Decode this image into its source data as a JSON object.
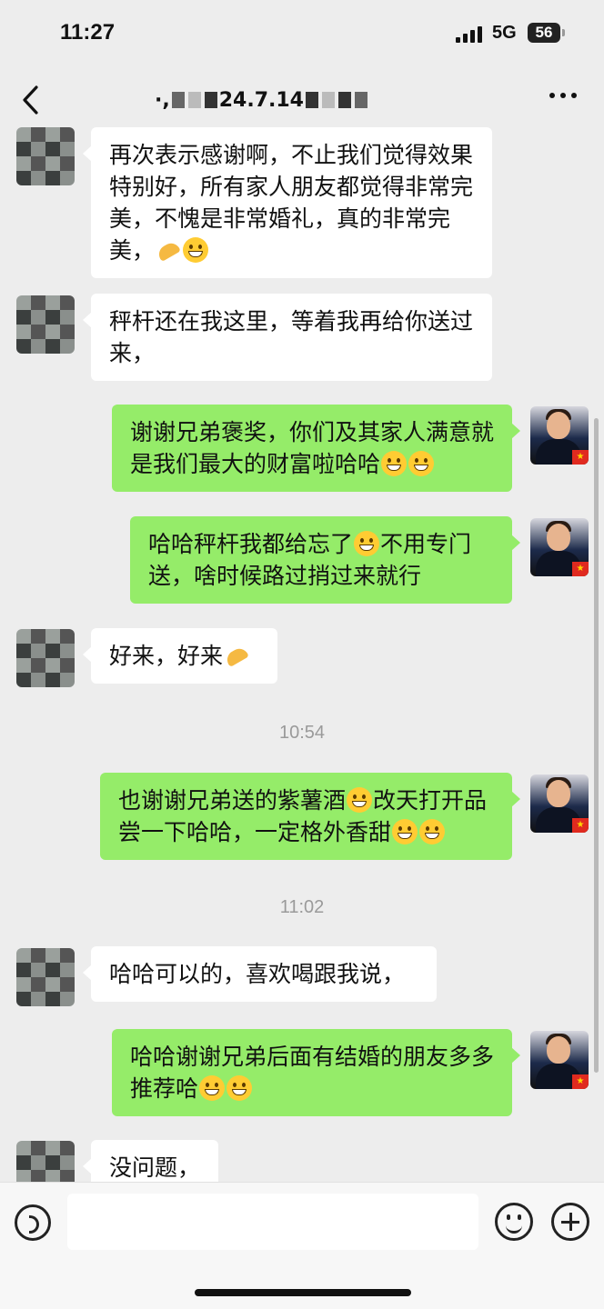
{
  "status_bar": {
    "time": "11:27",
    "network": "5G",
    "battery": "56"
  },
  "header": {
    "title_fragments": [
      "·",
      ",",
      "24.7.14"
    ]
  },
  "messages": [
    {
      "side": "in",
      "text": "再次表示感谢啊，不止我们觉得效果特别好，所有家人朋友都觉得非常完美，不愧是非常婚礼，真的非常完美，",
      "emojis": [
        "hand-icon",
        "grin-icon"
      ]
    },
    {
      "side": "in",
      "text": "秤杆还在我这里，等着我再给你送过来，",
      "emojis": []
    },
    {
      "side": "out",
      "text": "谢谢兄弟褒奖，你们及其家人满意就是我们最大的财富啦哈哈",
      "emojis": [
        "grin-icon",
        "grin-icon"
      ]
    },
    {
      "side": "out",
      "text_a": "哈哈秤杆我都给忘了",
      "text_b": "不用专门送，啥时候路过捎过来就行",
      "emojis": [
        "laugh-cry-icon"
      ]
    },
    {
      "side": "in",
      "text": "好来，好来",
      "emojis": [
        "hand-icon"
      ]
    },
    {
      "timestamp": "10:54"
    },
    {
      "side": "out",
      "text_a": "也谢谢兄弟送的紫薯酒",
      "text_b": "改天打开品尝一下哈哈，一定格外香甜",
      "emojis": [
        "laugh-cry-icon",
        "grin-icon",
        "grin-icon"
      ]
    },
    {
      "timestamp": "11:02"
    },
    {
      "side": "in",
      "text": "哈哈可以的，喜欢喝跟我说，",
      "emojis": []
    },
    {
      "side": "out",
      "text": "哈哈谢谢兄弟后面有结婚的朋友多多推荐哈",
      "emojis": [
        "grin-icon",
        "grin-icon"
      ]
    },
    {
      "side": "in",
      "text": "没问题，",
      "emojis": []
    }
  ],
  "colors": {
    "background": "#ededed",
    "incoming_bubble": "#ffffff",
    "outgoing_bubble": "#95ec69"
  }
}
